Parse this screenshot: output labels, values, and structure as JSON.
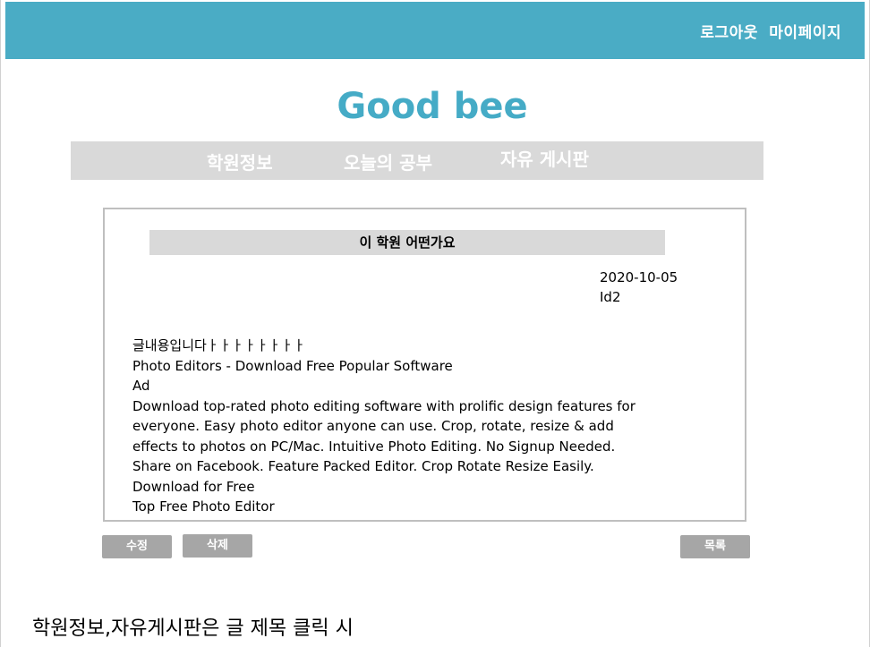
{
  "header": {
    "logout_label": "로그아웃",
    "mypage_label": "마이페이지",
    "bar_color": "#4aacc5"
  },
  "logo": {
    "text": "Good bee",
    "color": "#45abc6"
  },
  "nav": {
    "items": [
      {
        "label": "학원정보"
      },
      {
        "label": "오늘의 공부"
      },
      {
        "label": "자유 게시판"
      }
    ]
  },
  "post": {
    "title": "이 학원 어떤가요",
    "date": "2020-10-05",
    "author": "Id2",
    "body_lines": [
      "글내용입니다ㅏㅏㅏㅏㅏㅏㅏㅏ",
      "Photo Editors - Download Free Popular Software",
      "Ad",
      "Download top-rated photo editing software with prolific design features for",
      "everyone. Easy photo editor anyone can use. Crop, rotate, resize & add",
      "effects to photos on PC/Mac. Intuitive Photo Editing. No Signup Needed.",
      "Share on Facebook. Feature Packed Editor. Crop Rotate Resize Easily.",
      "Download for Free",
      "Top Free Photo Editor"
    ]
  },
  "buttons": {
    "edit_label": "수정",
    "delete_label": "삭제",
    "list_label": "목록"
  },
  "footer_note": "학원정보,자유게시판은 글 제목 클릭 시"
}
